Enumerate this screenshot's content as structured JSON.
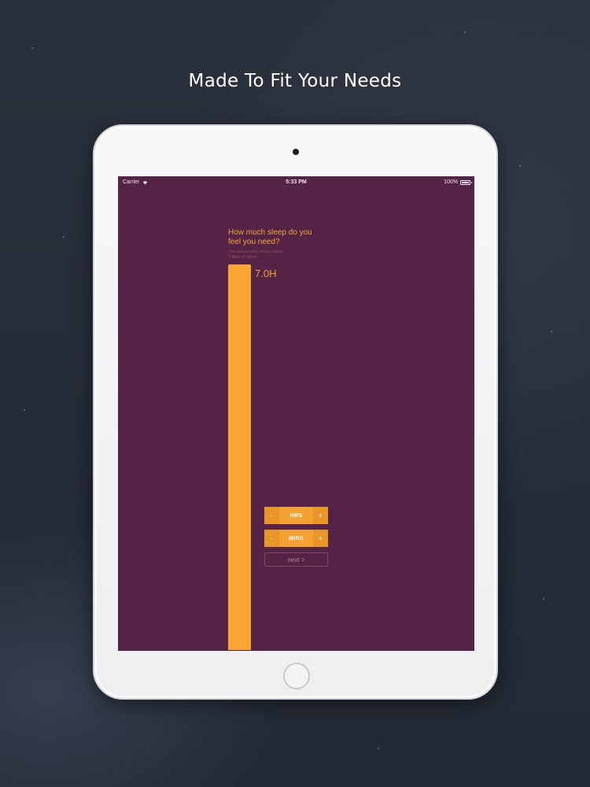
{
  "headline": "Made To Fit Your Needs",
  "status_bar": {
    "carrier": "Carrier",
    "time": "5:33 PM",
    "battery": "100%"
  },
  "screen": {
    "question": "How much sleep do you feel you need?",
    "hint": "The avg person needs about 7-8hrs of sleep",
    "value_label": "7.0H",
    "sleep_bar_fill_fraction": 1.0,
    "hours_stepper": {
      "minus": "-",
      "label": "HRS",
      "plus": "+"
    },
    "minutes_stepper": {
      "minus": "-",
      "label": "MINS",
      "plus": "+"
    },
    "next_button": "next >"
  },
  "colors": {
    "screen_background": "#552346",
    "accent_orange": "#f9a534",
    "page_background": "#262c37"
  }
}
